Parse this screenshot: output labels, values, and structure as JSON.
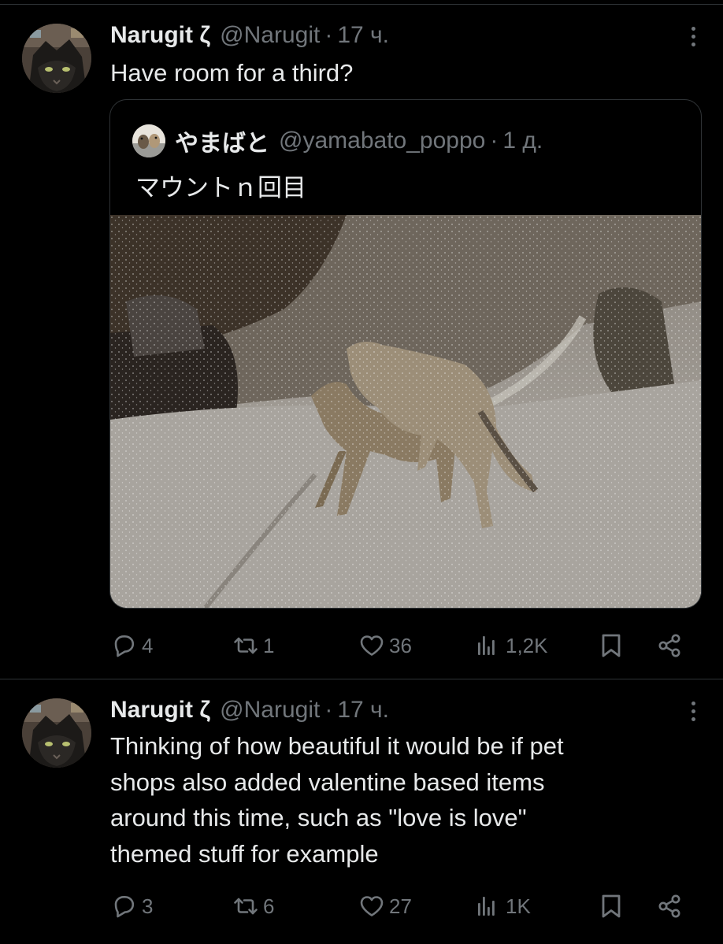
{
  "tweets": [
    {
      "author": {
        "name": "Narugit ζ",
        "handle": "@Narugit",
        "dot": "·",
        "time": "17 ч."
      },
      "text": "Have room for a third?",
      "quote": {
        "author": {
          "name": "やまばと",
          "handle": "@yamabato_poppo",
          "dot": "·",
          "time": "1 д."
        },
        "text": "マウントｎ回目",
        "photo": {
          "icon": "photo-two-wolves-in-snow"
        }
      },
      "stats": {
        "replies": "4",
        "retweets": "1",
        "likes": "36",
        "views": "1,2K"
      }
    },
    {
      "author": {
        "name": "Narugit ζ",
        "handle": "@Narugit",
        "dot": "·",
        "time": "17 ч."
      },
      "text_lines": [
        "Thinking of how beautiful it would be if pet",
        "shops also added valentine based items",
        "around this time, such as \"love is love\"",
        "themed stuff for example"
      ],
      "stats": {
        "replies": "3",
        "retweets": "6",
        "likes": "27",
        "views": "1K"
      }
    }
  ],
  "colors": {
    "background": "#000000",
    "text": "#e7e9ea",
    "muted": "#71767b",
    "border": "#2f3336"
  }
}
